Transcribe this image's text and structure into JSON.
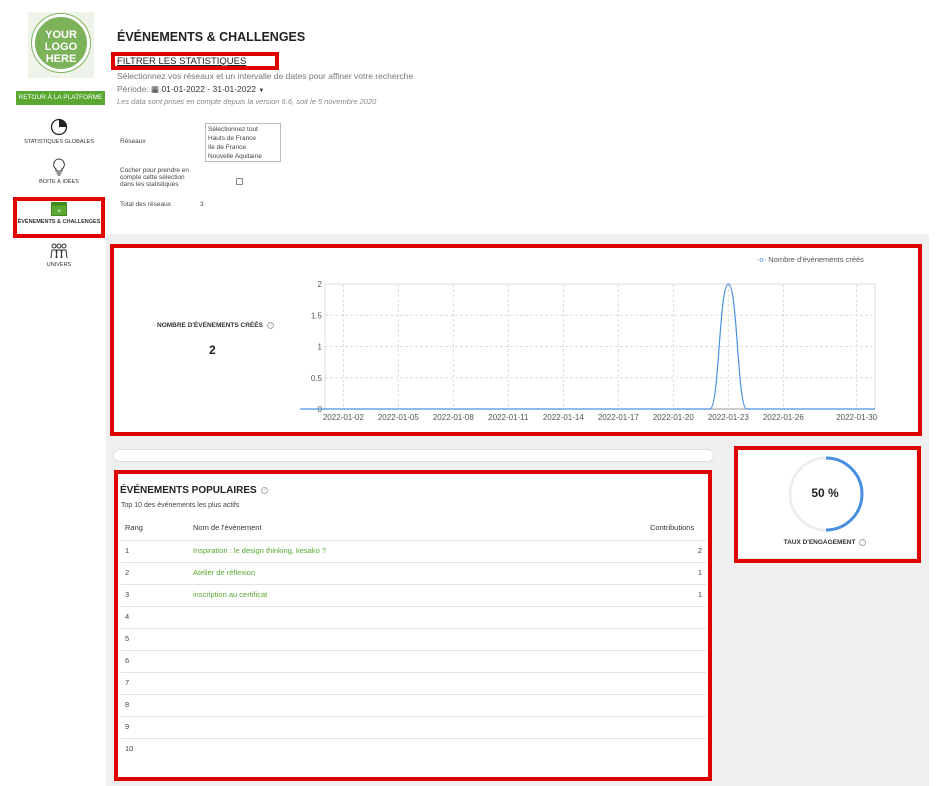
{
  "sidebar": {
    "logo_text_1": "YOUR",
    "logo_text_2": "LOGO",
    "logo_text_3": "HERE",
    "back_button": "RETOUR À LA PLATFORME",
    "items": [
      {
        "label": "STATISTIQUES GLOBALES",
        "icon": "pie-chart-icon"
      },
      {
        "label": "BOITE À IDÉES",
        "icon": "lightbulb-icon"
      },
      {
        "label": "ÉVÉNEMENTS & CHALLENGES",
        "icon": "calendar-icon"
      },
      {
        "label": "UNIVERS",
        "icon": "people-icon"
      }
    ]
  },
  "header": {
    "title": "ÉVÉNEMENTS & CHALLENGES",
    "filter_title": "FILTRER LES STATISTIQUES",
    "subtitle": "Sélectionnez vos réseaux et un intervalle de dates pour affiner votre recherche",
    "period_label": "Période:",
    "period_value": "01-01-2022 - 31-01-2022",
    "note": "Les data sont prises en compte depuis la version 6.6, soit le 5 novembre 2020"
  },
  "filters": {
    "networks_label": "Réseaux",
    "networks_options": [
      "Sélectionnez tout",
      "Hauts de France",
      "Ile de France",
      "Nouvelle Aquitaine"
    ],
    "checkbox_label": "Cocher pour prendre en compte cette sélection dans les statistiques",
    "total_label": "Total des réseaux",
    "total_value": "3"
  },
  "kpi": {
    "events_label": "NOMBRE D'ÉVÉNEMENTS CRÉÉS",
    "events_value": "2"
  },
  "chart_data": {
    "type": "line",
    "series": [
      {
        "name": "Nombre d'événements créés",
        "color": "#4a90e2",
        "x": [
          "2022-01-21",
          "2022-01-22",
          "2022-01-23",
          "2022-01-24",
          "2022-01-25"
        ],
        "values": [
          0,
          0,
          2,
          0,
          0
        ]
      }
    ],
    "x_ticks": [
      "2022-01-02",
      "2022-01-05",
      "2022-01-08",
      "2022-01-11",
      "2022-01-14",
      "2022-01-17",
      "2022-01-20",
      "2022-01-23",
      "2022-01-26",
      "2022-01-30"
    ],
    "y_ticks": [
      "0",
      "0.5",
      "1",
      "1.5",
      "2"
    ],
    "ylim": [
      0,
      2
    ],
    "legend": "top-right",
    "grid": true
  },
  "popular": {
    "title": "ÉVÉNEMENTS POPULAIRES",
    "subtitle": "Top 10 des événements les plus actifs",
    "col_rank": "Rang",
    "col_name": "Nom de l'événement",
    "col_contrib": "Contributions",
    "rows": [
      {
        "rank": "1",
        "name": "Inspiration : le design thinking, kesako ?",
        "contrib": "2"
      },
      {
        "rank": "2",
        "name": "Atelier de réflexion",
        "contrib": "1"
      },
      {
        "rank": "3",
        "name": "inscription au certificat",
        "contrib": "1"
      },
      {
        "rank": "4",
        "name": "",
        "contrib": ""
      },
      {
        "rank": "5",
        "name": "",
        "contrib": ""
      },
      {
        "rank": "6",
        "name": "",
        "contrib": ""
      },
      {
        "rank": "7",
        "name": "",
        "contrib": ""
      },
      {
        "rank": "8",
        "name": "",
        "contrib": ""
      },
      {
        "rank": "9",
        "name": "",
        "contrib": ""
      },
      {
        "rank": "10",
        "name": "",
        "contrib": ""
      }
    ]
  },
  "engagement": {
    "value": "50 %",
    "fraction": 0.5,
    "label": "TAUX D'ENGAGEMENT"
  },
  "colors": {
    "accent": "#5aa832",
    "chart": "#4a90e2",
    "highlight": "#e00000"
  }
}
